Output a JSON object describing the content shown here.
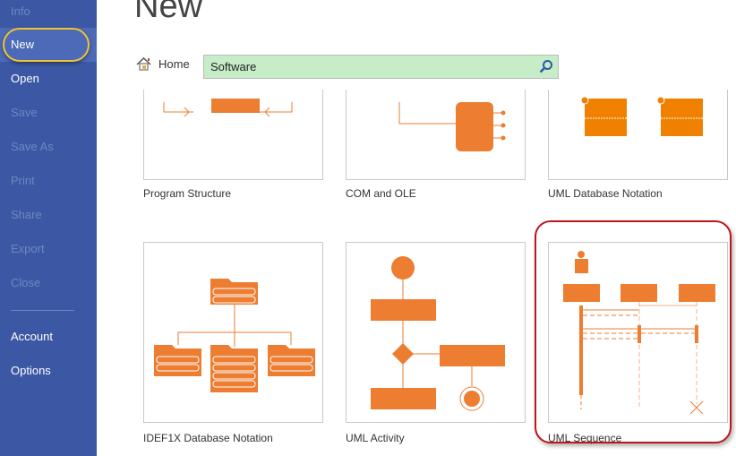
{
  "sidebar": {
    "items": [
      {
        "label": "Info",
        "enabled": false
      },
      {
        "label": "New",
        "enabled": true,
        "selected": true
      },
      {
        "label": "Open",
        "enabled": true
      },
      {
        "label": "Save",
        "enabled": false
      },
      {
        "label": "Save As",
        "enabled": false
      },
      {
        "label": "Print",
        "enabled": false
      },
      {
        "label": "Share",
        "enabled": false
      },
      {
        "label": "Export",
        "enabled": false
      },
      {
        "label": "Close",
        "enabled": false
      },
      {
        "label": "Account",
        "enabled": true
      },
      {
        "label": "Options",
        "enabled": true
      }
    ]
  },
  "header": {
    "title": "New",
    "home_label": "Home",
    "home_icon": "house-icon",
    "search_value": "Software",
    "search_icon": "magnifier-icon"
  },
  "templates": [
    {
      "label": "Program Structure"
    },
    {
      "label": "COM and OLE"
    },
    {
      "label": "UML Database Notation"
    },
    {
      "label": "IDEF1X Database Notation"
    },
    {
      "label": "UML Activity"
    },
    {
      "label": "UML Sequence",
      "highlighted": true
    }
  ],
  "colors": {
    "sidebar": "#3c58a4",
    "accent": "#ed7d31",
    "search_bg": "#c6ecc8",
    "highlight_ring": "#c0151b"
  }
}
